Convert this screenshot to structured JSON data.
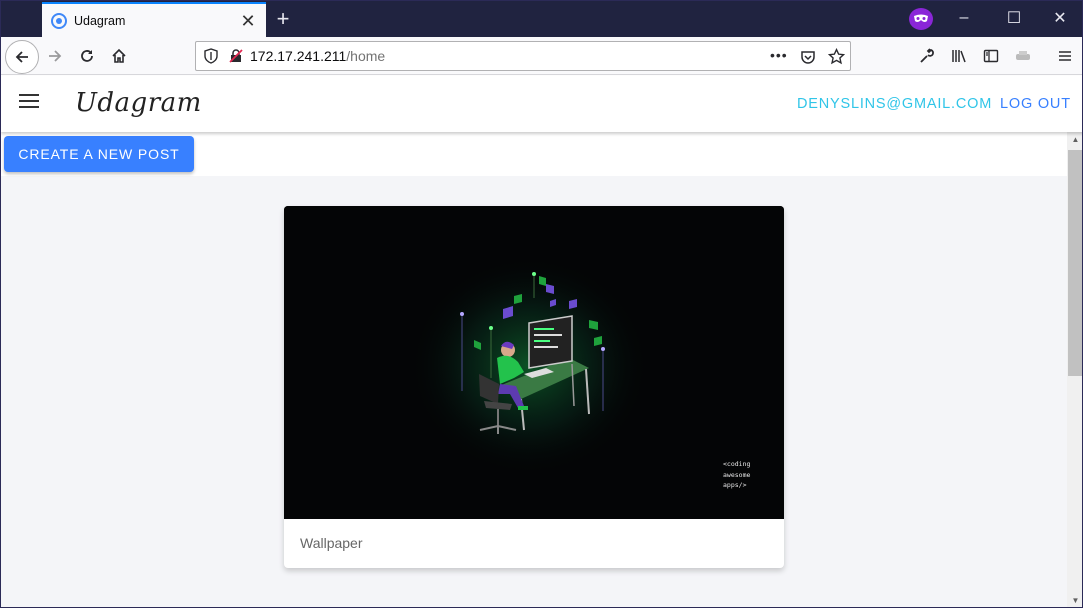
{
  "browser": {
    "tab_title": "Udagram",
    "tab_close": "✕",
    "new_tab": "+",
    "url_host": "172.17.241.211",
    "url_path": "/home",
    "url_more": "•••",
    "window_minimize": "–",
    "window_maximize": "☐",
    "window_close": "✕"
  },
  "app": {
    "brand": "Udagram",
    "user_email": "DENYSLINS@GMAIL.COM",
    "logout_label": "LOG OUT",
    "create_post_label": "CREATE A NEW POST"
  },
  "feed": {
    "posts": [
      {
        "caption": "Wallpaper",
        "image_text": [
          "<coding",
          "awesome",
          "apps/>"
        ]
      }
    ]
  },
  "colors": {
    "primary": "#3880ff",
    "secondary": "#30c5e8",
    "tabstrip": "#202340",
    "private_badge": "#8a26d8"
  }
}
